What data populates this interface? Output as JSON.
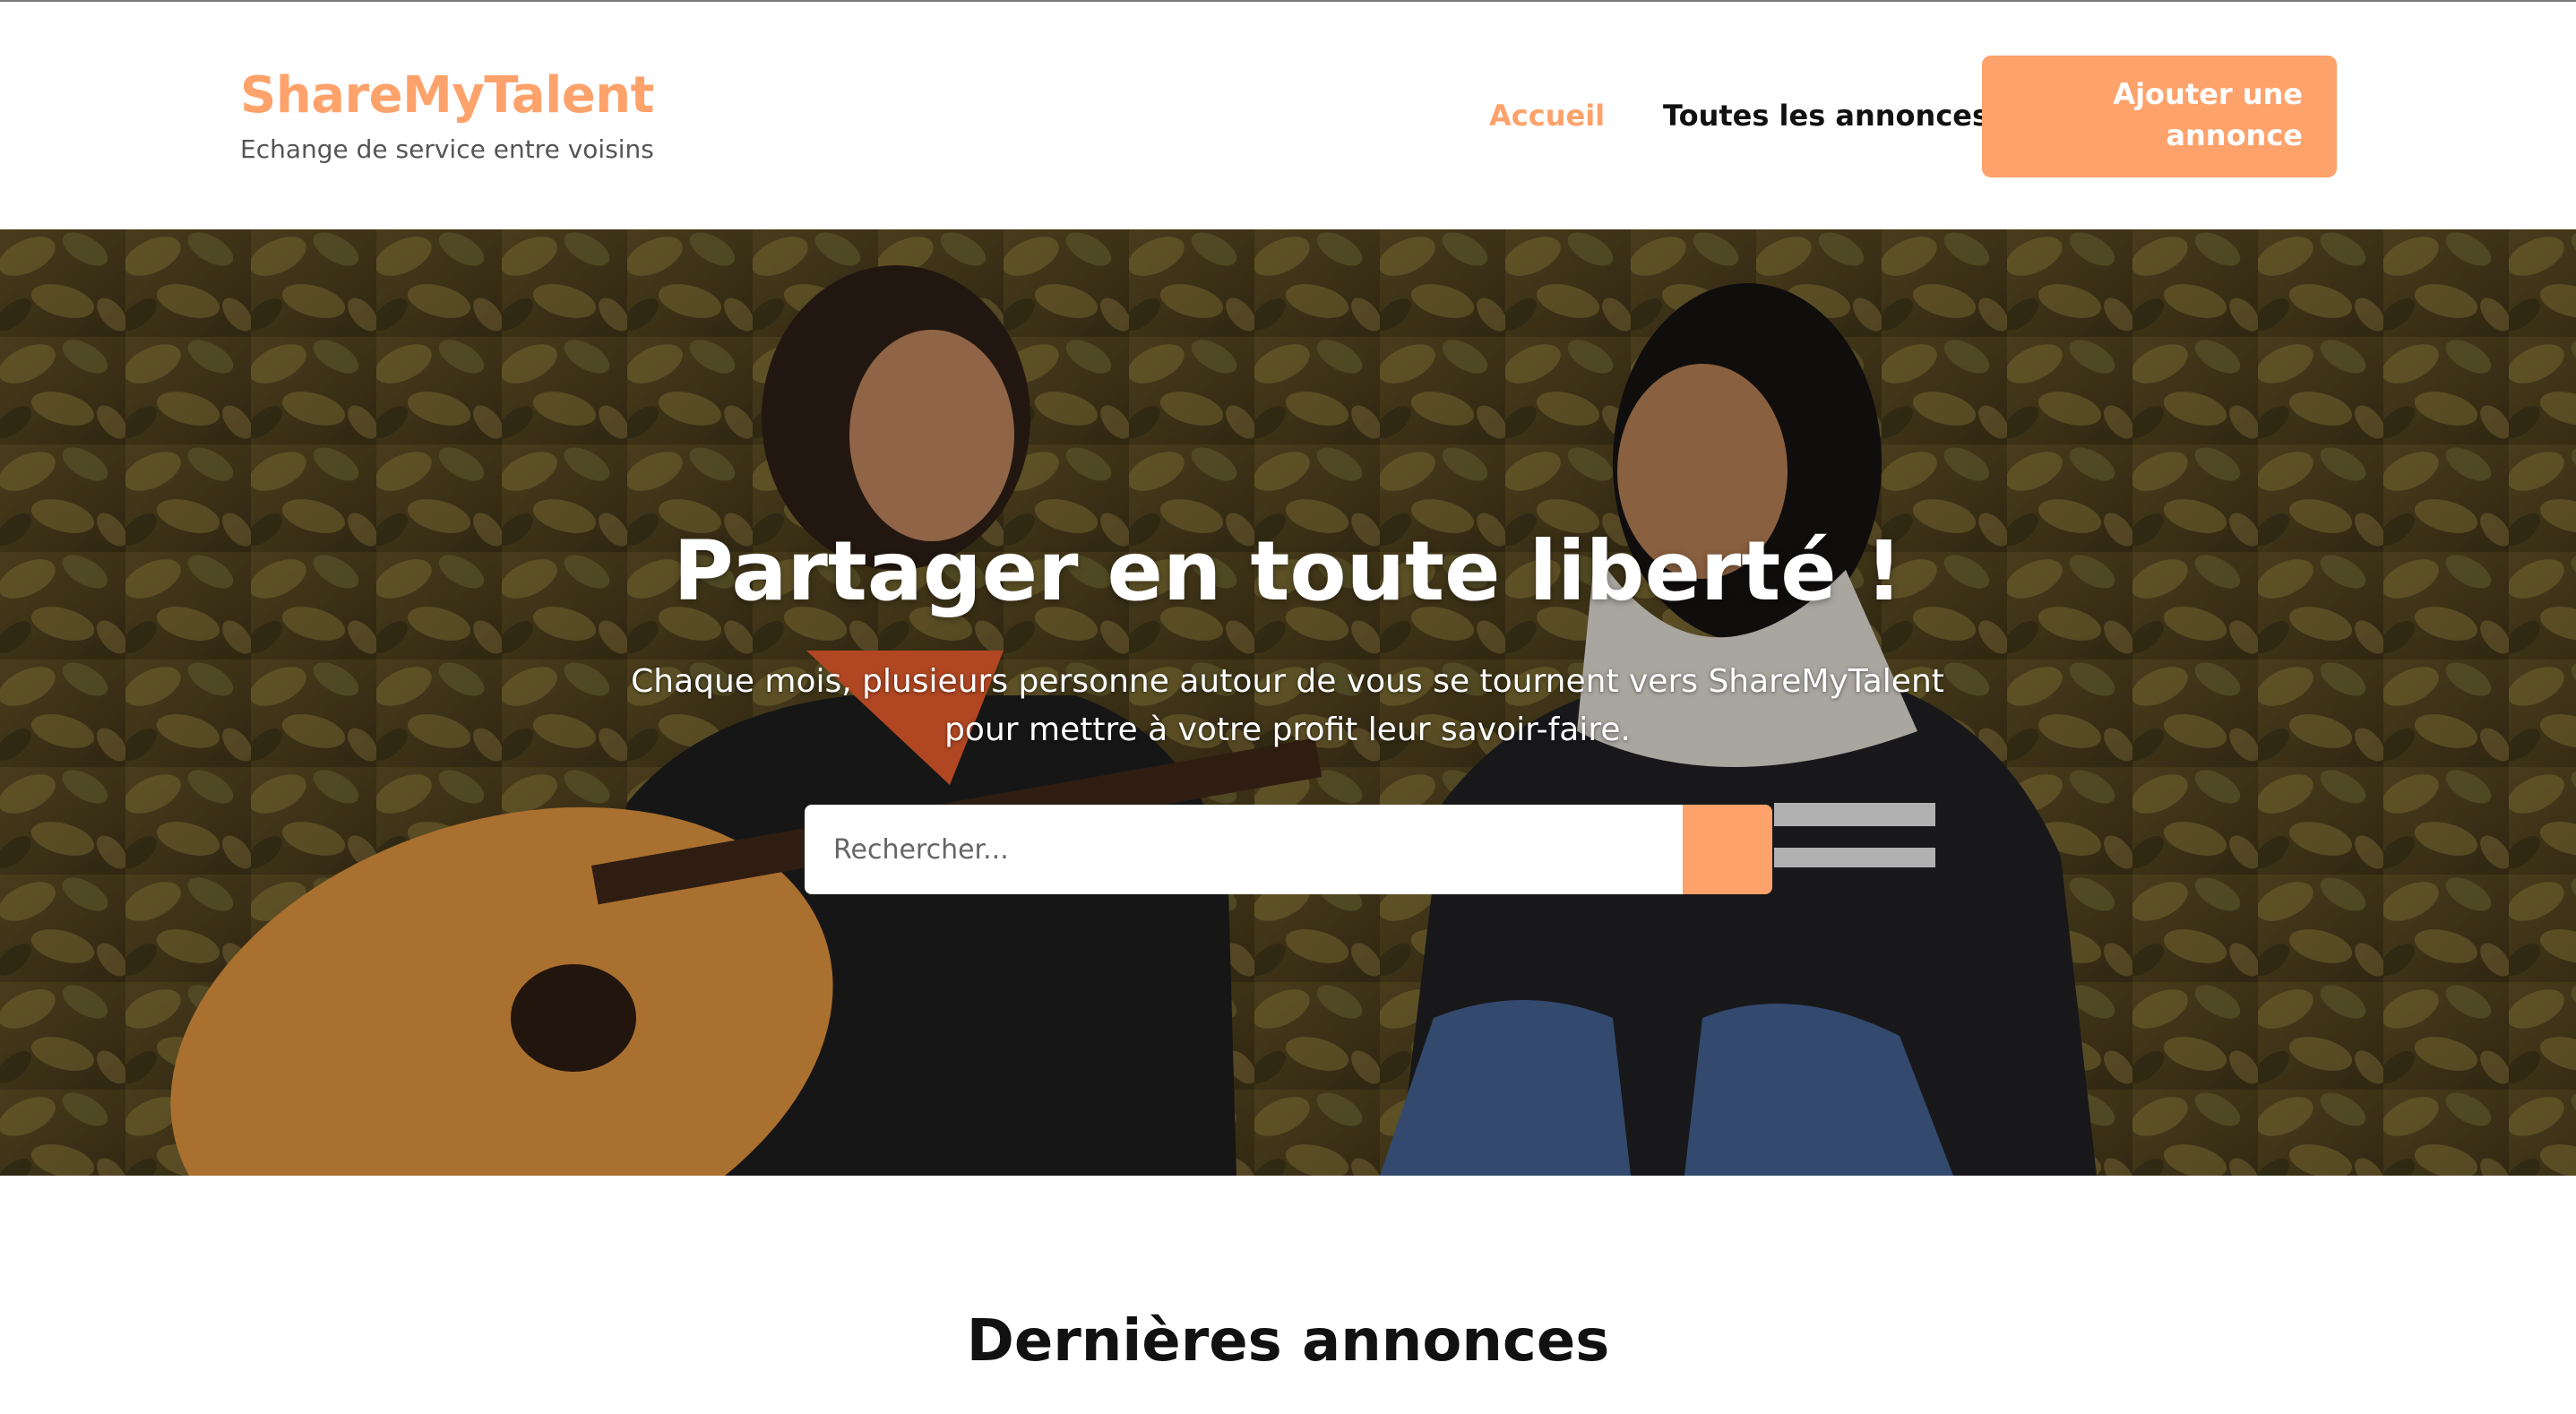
{
  "header": {
    "brand_title": "ShareMyTalent",
    "brand_subtitle": "Echange de service entre voisins",
    "nav": {
      "home": "Accueil",
      "all_listings": "Toutes les annonces"
    },
    "cta_line1": "Ajouter une",
    "cta_line2": "annonce"
  },
  "hero": {
    "title": "Partager en toute liberté !",
    "text": "Chaque mois, plusieurs personne autour de vous se tournent vers ShareMyTalent pour mettre à votre profit leur savoir-faire.",
    "search": {
      "placeholder": "Rechercher...",
      "value": ""
    }
  },
  "main": {
    "section_title": "Dernières annonces"
  },
  "colors": {
    "accent": "#fda26b",
    "text_dark": "#111111",
    "text_muted": "#555555"
  },
  "icons": {
    "search_button": "search-icon"
  }
}
